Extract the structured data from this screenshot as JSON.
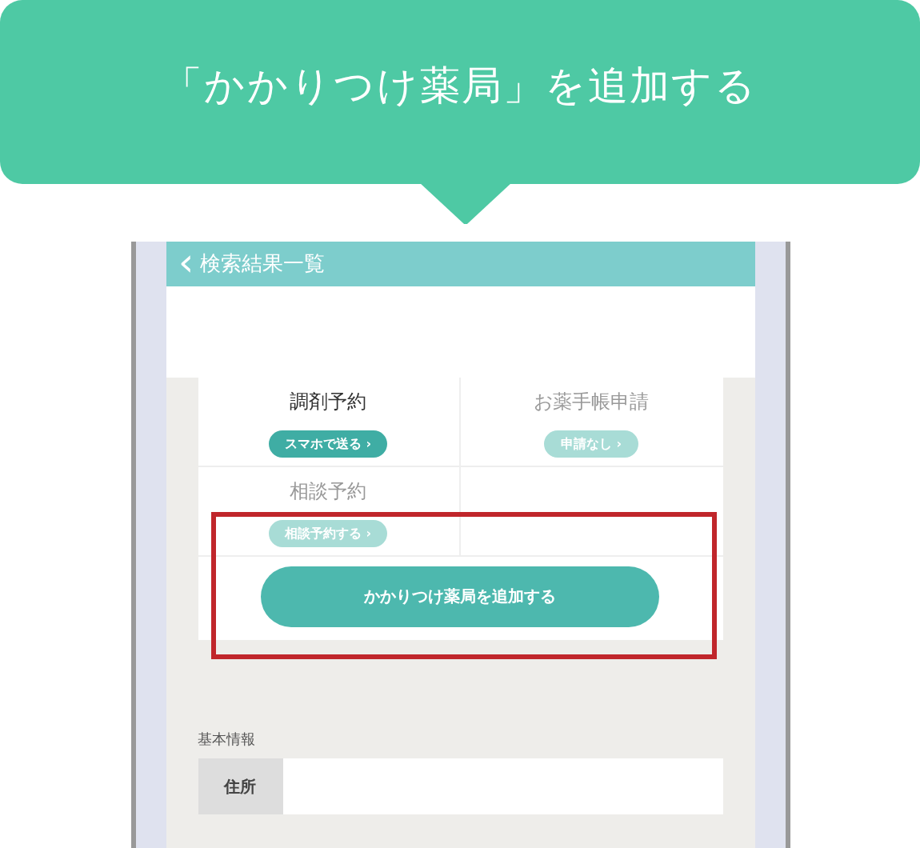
{
  "callout": {
    "title": "「かかりつけ薬局」を追加する"
  },
  "screen": {
    "back_icon": "‹",
    "header_title": "検索結果一覧",
    "services": [
      {
        "title": "調剤予約",
        "button": "スマホで送る ›",
        "enabled": true
      },
      {
        "title": "お薬手帳申請",
        "button": "申請なし ›",
        "enabled": false
      },
      {
        "title": "相談予約",
        "button": "相談予約する ›",
        "enabled": false
      }
    ],
    "add_button": {
      "label": "かかりつけ薬局を追加する",
      "highlighted": true
    },
    "section_title": "基本情報",
    "info_rows": [
      {
        "label": "住所"
      }
    ]
  }
}
